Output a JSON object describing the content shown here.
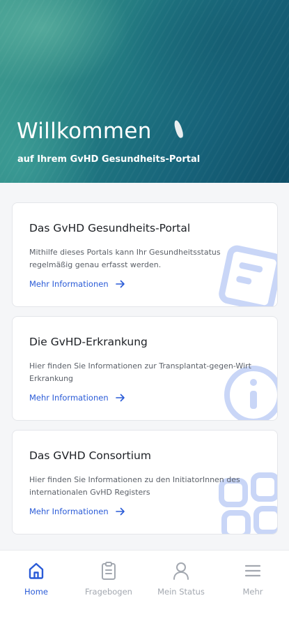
{
  "hero": {
    "title": "Willkommen",
    "subtitle": "auf Ihrem GvHD Gesundheits-Portal"
  },
  "cards": [
    {
      "title": "Das GvHD Gesundheits-Portal",
      "text": "Mithilfe dieses Portals kann Ihr Gesundheitsstatus regelmäßig genau erfasst werden.",
      "link": "Mehr Informationen",
      "icon": "form-icon"
    },
    {
      "title": "Die GvHD-Erkrankung",
      "text": "Hier finden Sie Informationen zur Transplantat-gegen-Wirt Erkrankung",
      "link": "Mehr Informationen",
      "icon": "info-icon"
    },
    {
      "title": "Das GVHD Consortium",
      "text": "Hier finden Sie Informationen zu den InitiatorInnen des internationalen GvHD Registers",
      "link": "Mehr Informationen",
      "icon": "grid-icon"
    }
  ],
  "tabs": [
    {
      "label": "Home",
      "icon": "home-icon",
      "active": true
    },
    {
      "label": "Fragebogen",
      "icon": "clipboard-icon",
      "active": false
    },
    {
      "label": "Mein Status",
      "icon": "person-icon",
      "active": false
    },
    {
      "label": "Mehr",
      "icon": "menu-icon",
      "active": false
    }
  ],
  "colors": {
    "accent": "#2a5bd7",
    "decoration": "#c9d6f7",
    "inactive_tab": "#a3a8b0"
  }
}
